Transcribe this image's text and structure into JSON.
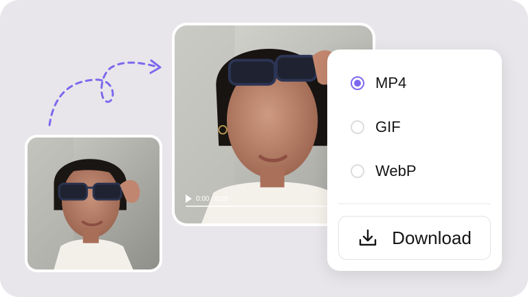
{
  "video": {
    "time": "0:00 / 0:05"
  },
  "formats": [
    {
      "label": "MP4",
      "selected": true
    },
    {
      "label": "GIF",
      "selected": false
    },
    {
      "label": "WebP",
      "selected": false
    }
  ],
  "download": {
    "label": "Download",
    "icon": "download-icon"
  },
  "colors": {
    "accent": "#7b68ee",
    "background": "#e8e6ea",
    "panel": "#ffffff"
  }
}
